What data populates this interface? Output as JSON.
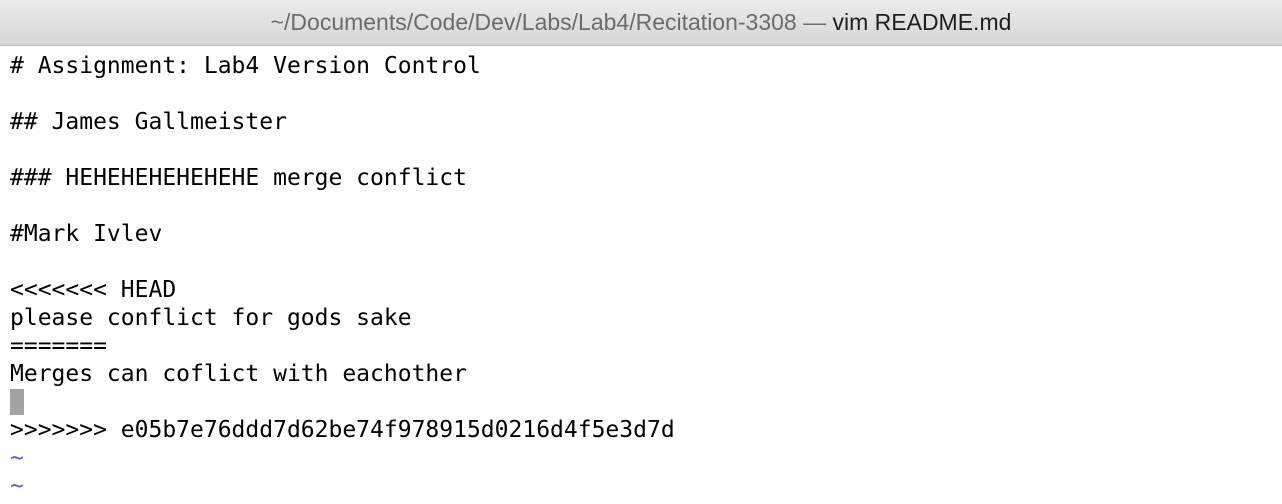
{
  "window": {
    "title_path": "~/Documents/Code/Dev/Labs/Lab4/Recitation-3308",
    "title_separator": " — ",
    "title_command": "vim README.md"
  },
  "editor": {
    "lines": [
      "# Assignment: Lab4 Version Control",
      "",
      "## James Gallmeister",
      "",
      "### HEHEHEHEHEHEHE merge conflict",
      "",
      "#Mark Ivlev",
      "",
      "<<<<<<< HEAD",
      "please conflict for gods sake",
      "=======",
      "Merges can coflict with eachother",
      "",
      ">>>>>>> e05b7e76ddd7d62be74f978915d0216d4f5e3d7d"
    ],
    "cursor_line": 13,
    "empty_line_marker": "~",
    "empty_line_count": 2,
    "colors": {
      "text": "#000000",
      "tilde": "#6a55e6",
      "cursor": "#a3a3a3"
    }
  }
}
